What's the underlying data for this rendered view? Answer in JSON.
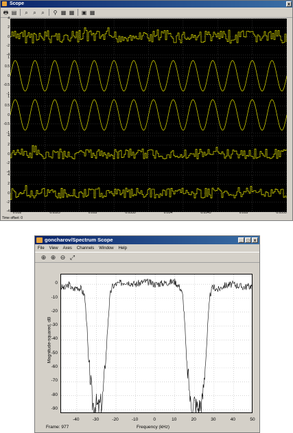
{
  "scope": {
    "title": "Scope",
    "close_label": "x",
    "toolbar": [
      "🖶",
      "▤",
      "⌕",
      "⌕",
      "⌕",
      "⚲",
      "▦",
      "▦",
      "▣",
      "▦"
    ],
    "ylabels": [
      [
        "4",
        "2",
        "0",
        "-2",
        "-4"
      ],
      [
        "1",
        "0.5",
        "0",
        "-0.5",
        "-1"
      ],
      [
        "1",
        "0.5",
        "0",
        "-0.5",
        "-1"
      ],
      [
        "4",
        "2",
        "0",
        "-2",
        "-4"
      ],
      [
        "4",
        "2",
        "0",
        "-2",
        "-4"
      ]
    ],
    "xticks": [
      "0.052",
      "0.0525",
      "0.053",
      "0.0535",
      "0.054",
      "0.0545",
      "0.055",
      "0.0555"
    ],
    "time_offset_label": "Time offset:",
    "time_offset_value": "0"
  },
  "spectrum": {
    "title": "goncharov/Spectrum Scope",
    "menu": [
      "File",
      "View",
      "Axes",
      "Channels",
      "Window",
      "Help"
    ],
    "window_buttons": [
      "_",
      "□",
      "x"
    ],
    "ylabel": "Magnitude-squared, dB",
    "xlabel": "Frequency (kHz)",
    "frame_label": "Frame: 977",
    "yticks": [
      "0",
      "-10",
      "-20",
      "-30",
      "-40",
      "-50",
      "-60",
      "-70",
      "-80",
      "-90"
    ],
    "xticks": [
      "-40",
      "-30",
      "-20",
      "-10",
      "0",
      "10",
      "20",
      "30",
      "40",
      "50"
    ]
  },
  "chart_data": {
    "type": "line",
    "xlabel": "Frequency (kHz)",
    "ylabel": "Magnitude-squared, dB",
    "xlim": [
      -48,
      50
    ],
    "ylim": [
      -93,
      7
    ],
    "grid": true,
    "series": [
      {
        "x": [
          -48,
          -46,
          -44,
          -42,
          -40,
          -38,
          -36,
          -35,
          -34,
          -33,
          -32,
          -31,
          -30,
          -29,
          -28,
          -27,
          -26,
          -25,
          -24,
          -23,
          -22,
          -20,
          -15,
          -10,
          -5,
          0,
          5,
          10,
          13,
          14,
          15,
          16,
          17,
          18,
          19,
          20,
          21,
          22,
          23,
          24,
          25,
          26,
          27,
          28,
          29,
          30,
          32,
          35,
          40,
          45,
          50
        ],
        "y": [
          -2,
          -3,
          0,
          -4,
          -2,
          -3,
          -8,
          -25,
          -55,
          -68,
          -85,
          -87,
          -86,
          -89,
          -86,
          -85,
          -68,
          -50,
          -25,
          -8,
          -2,
          0,
          2,
          0,
          2,
          0,
          1,
          2,
          -3,
          -8,
          -25,
          -55,
          -68,
          -85,
          -88,
          -84,
          -87,
          -89,
          -86,
          -84,
          -68,
          -50,
          -25,
          -8,
          -3,
          -2,
          -4,
          -1,
          0,
          -2,
          -1
        ]
      }
    ]
  }
}
